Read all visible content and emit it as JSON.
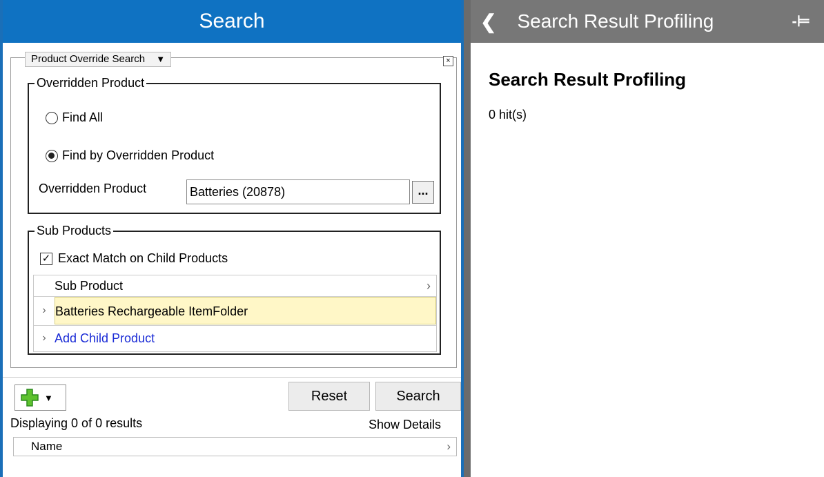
{
  "left": {
    "title": "Search",
    "search_type": {
      "label": "Product Override Search"
    },
    "overridden_group": {
      "legend": "Overridden Product",
      "find_all": "Find All",
      "find_by": "Find by Overridden Product",
      "product_label": "Overridden Product",
      "product_value": "Batteries (20878)",
      "browse_label": "..."
    },
    "sub_group": {
      "legend": "Sub Products",
      "exact_match": "Exact Match on Child Products",
      "grid_header": "Sub Product",
      "rows": [
        {
          "label": "Batteries Rechargeable ItemFolder"
        }
      ],
      "add_label": "Add Child Product"
    },
    "reset_label": "Reset",
    "search_label": "Search",
    "results_text": "Displaying 0 of 0 results",
    "show_details": "Show Details",
    "results_column": "Name"
  },
  "right": {
    "header_title": "Search Result Profiling",
    "heading": "Search Result Profiling",
    "hits": "0 hit(s)"
  },
  "colors": {
    "header_blue": "#0f72c2",
    "right_header_grey": "#777777",
    "row_highlight": "#fff7c7",
    "link_blue": "#0000ee"
  },
  "icons": {
    "back": "chevron-left-icon",
    "pin": "pin-icon",
    "add": "green-plus-icon",
    "dropdown": "caret-down-icon",
    "close": "close-box-icon"
  }
}
